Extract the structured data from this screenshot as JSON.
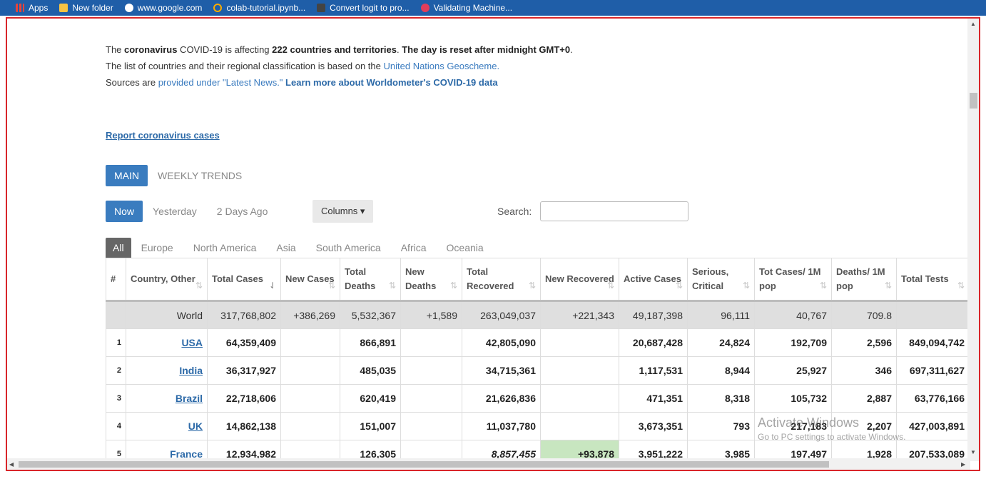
{
  "bookmarks": [
    {
      "label": "Apps",
      "icon": "apps-grid-icon",
      "color": "#e8443a"
    },
    {
      "label": "New folder",
      "icon": "folder-icon",
      "color": "#f6c343"
    },
    {
      "label": "www.google.com",
      "icon": "google-icon",
      "color": "#ffffff"
    },
    {
      "label": "colab-tutorial.ipynb...",
      "icon": "colab-icon",
      "color": "#f9ab00"
    },
    {
      "label": "Convert logit to pro...",
      "icon": "page-icon",
      "color": "#555555"
    },
    {
      "label": "Validating Machine...",
      "icon": "youtube-icon",
      "color": "#e23d5a"
    }
  ],
  "intro": {
    "t1": "The ",
    "b1": "coronavirus",
    "t2": " COVID-19 is affecting ",
    "b2": "222 countries and territories",
    "t3": ". ",
    "b3": "The day is reset after midnight GMT+0",
    "t4": ". The list of countries and their regional classification is based on the ",
    "l1": "United Nations Geoscheme.",
    "t5": "Sources are ",
    "l2": "provided under \"Latest News.\"",
    "t6": " ",
    "l3": "Learn more about Worldometer's COVID-19 data"
  },
  "report_link": "Report coronavirus cases",
  "main_tabs": [
    "MAIN",
    "WEEKLY TRENDS"
  ],
  "day_tabs": [
    "Now",
    "Yesterday",
    "2 Days Ago"
  ],
  "columns_button": "Columns ▾",
  "search_label": "Search:",
  "regions": [
    "All",
    "Europe",
    "North America",
    "Asia",
    "South America",
    "Africa",
    "Oceania"
  ],
  "table": {
    "headers": [
      "#",
      "Country, Other",
      "Total Cases",
      "New Cases",
      "Total Deaths",
      "New Deaths",
      "Total Recovered",
      "New Recovered",
      "Active Cases",
      "Serious, Critical",
      "Tot Cases/ 1M pop",
      "Deaths/ 1M pop",
      "Total Tests"
    ],
    "sort_icon": "⇅",
    "sort_active_icon": "⇃",
    "world": [
      "",
      "World",
      "317,768,802",
      "+386,269",
      "5,532,367",
      "+1,589",
      "263,049,037",
      "+221,343",
      "49,187,398",
      "96,111",
      "40,767",
      "709.8",
      ""
    ],
    "rows": [
      [
        "1",
        "USA",
        "64,359,409",
        "",
        "866,891",
        "",
        "42,805,090",
        "",
        "20,687,428",
        "24,824",
        "192,709",
        "2,596",
        "849,094,742"
      ],
      [
        "2",
        "India",
        "36,317,927",
        "",
        "485,035",
        "",
        "34,715,361",
        "",
        "1,117,531",
        "8,944",
        "25,927",
        "346",
        "697,311,627"
      ],
      [
        "3",
        "Brazil",
        "22,718,606",
        "",
        "620,419",
        "",
        "21,626,836",
        "",
        "471,351",
        "8,318",
        "105,732",
        "2,887",
        "63,776,166"
      ],
      [
        "4",
        "UK",
        "14,862,138",
        "",
        "151,007",
        "",
        "11,037,780",
        "",
        "3,673,351",
        "793",
        "217,183",
        "2,207",
        "427,003,891"
      ],
      [
        "5",
        "France",
        "12,934,982",
        "",
        "126,305",
        "",
        "8,857,455",
        "+93,878",
        "3,951,222",
        "3,985",
        "197,497",
        "1,928",
        "207,533,089"
      ]
    ]
  },
  "watermark": {
    "line1": "Activate Windows",
    "line2": "Go to PC settings to activate Windows."
  }
}
